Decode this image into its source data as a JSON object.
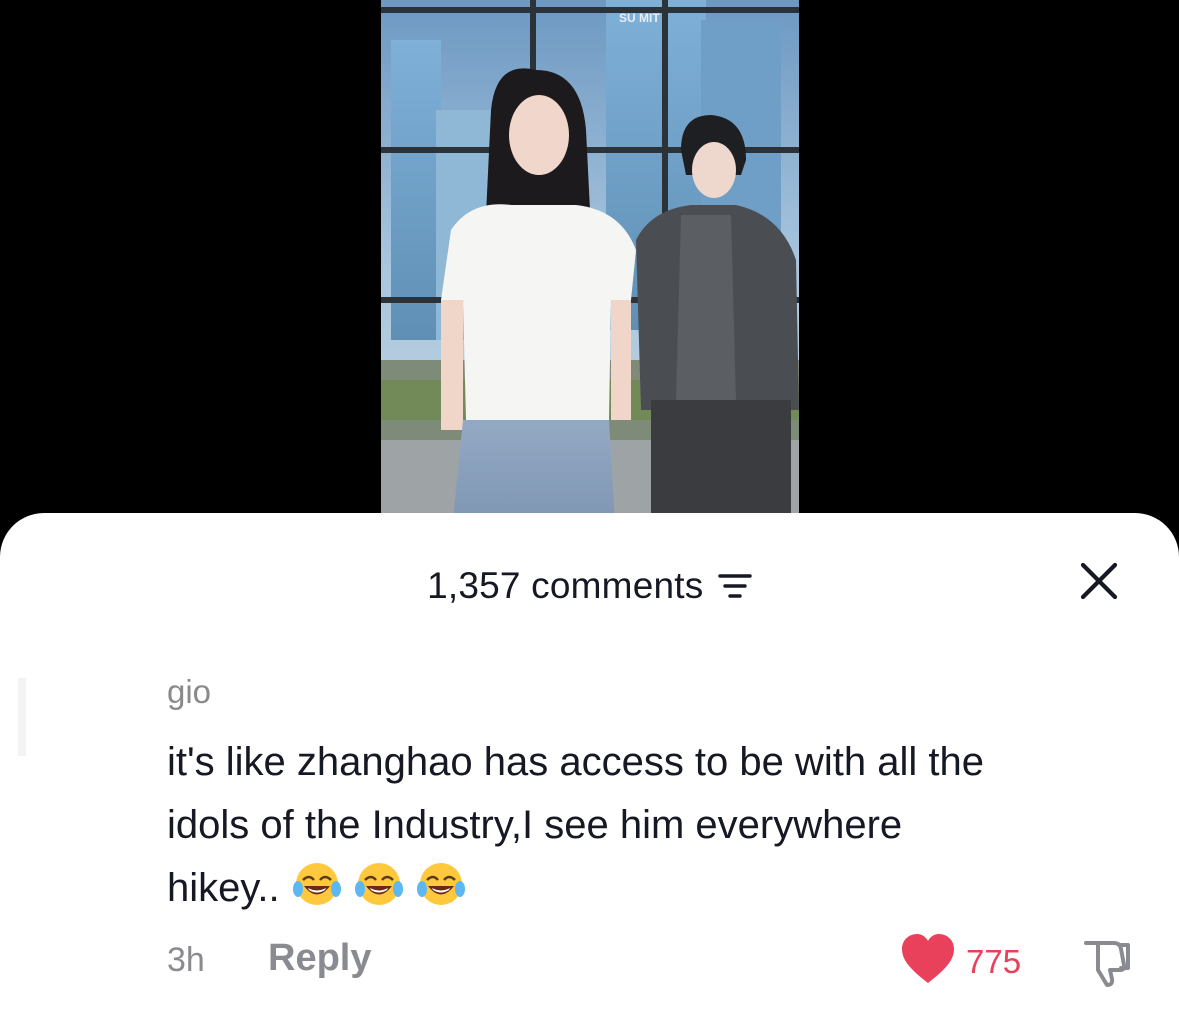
{
  "video": {
    "sign_text": "SU  MIT"
  },
  "header": {
    "comments_count": "1,357 comments"
  },
  "comment": {
    "username": "gio",
    "text_line1": "it's like zhanghao has access to be with all the",
    "text_line2": "idols of the Industry,I see him everywhere",
    "text_line3": "hikey..",
    "emojis": [
      "face-with-tears-of-joy",
      "face-with-tears-of-joy",
      "face-with-tears-of-joy"
    ],
    "time": "3h",
    "reply_label": "Reply",
    "likes": "775"
  },
  "colors": {
    "like": "#e9415b",
    "text": "#161823",
    "muted": "#8a8b91"
  },
  "icons": {
    "sort": "sort-icon",
    "close": "close-icon",
    "heart": "heart-icon",
    "dislike": "thumbs-down-icon"
  }
}
